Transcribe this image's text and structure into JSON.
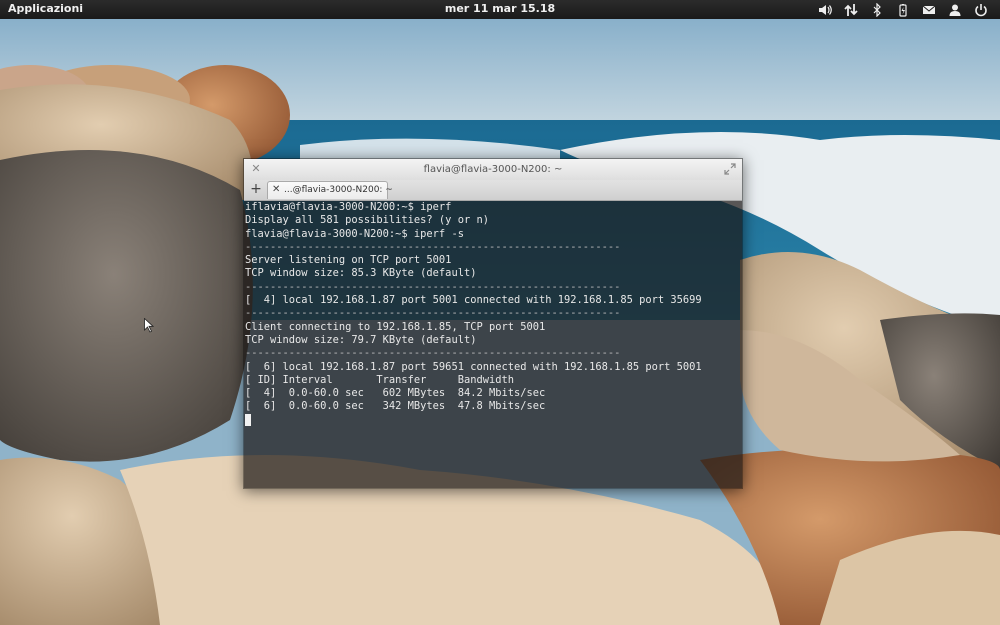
{
  "panel": {
    "apps_label": "Applicazioni",
    "clock": "mer 11 mar 15.18",
    "indicators": [
      "volume-icon",
      "network-icon",
      "bluetooth-icon",
      "battery-icon",
      "mail-icon",
      "user-icon",
      "power-icon"
    ]
  },
  "window": {
    "title": "flavia@flavia-3000-N200: ~",
    "new_tab": "+",
    "tab_close": "✕",
    "tab_label": "...@flavia-3000-N200: ~"
  },
  "terminal": {
    "lines": [
      "iflavia@flavia-3000-N200:~$ iperf",
      "Display all 581 possibilities? (y or n)",
      "flavia@flavia-3000-N200:~$ iperf -s",
      "------------------------------------------------------------",
      "Server listening on TCP port 5001",
      "TCP window size: 85.3 KByte (default)",
      "------------------------------------------------------------",
      "[  4] local 192.168.1.87 port 5001 connected with 192.168.1.85 port 35699",
      "------------------------------------------------------------",
      "Client connecting to 192.168.1.85, TCP port 5001",
      "TCP window size: 79.7 KByte (default)",
      "------------------------------------------------------------",
      "[  6] local 192.168.1.87 port 59651 connected with 192.168.1.85 port 5001",
      "[ ID] Interval       Transfer     Bandwidth",
      "[  4]  0.0-60.0 sec   602 MBytes  84.2 Mbits/sec",
      "[  6]  0.0-60.0 sec   342 MBytes  47.8 Mbits/sec"
    ]
  },
  "colors": {
    "panel_bg": "#1f1f1f",
    "terminal_bg": "#19161499",
    "terminal_fg": "#e8e8e8",
    "sky": "#a9c6d8",
    "sea": "#1f6f95"
  }
}
